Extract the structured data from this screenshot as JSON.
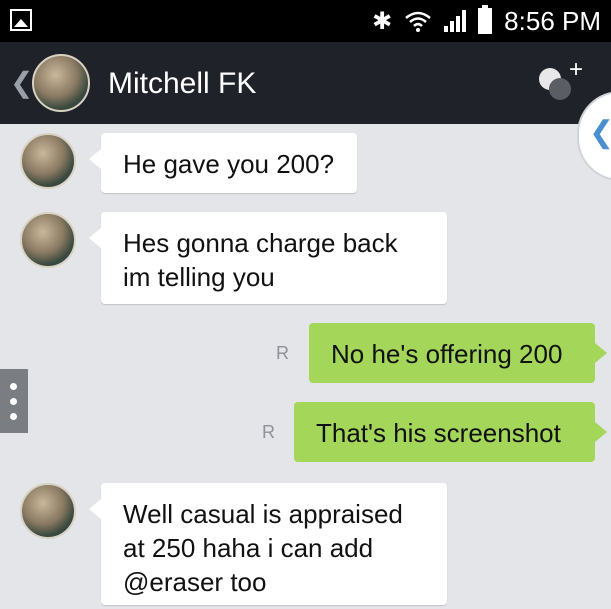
{
  "status_bar": {
    "time": "8:56 PM",
    "icons": [
      "gallery-icon",
      "bluetooth-icon",
      "wifi-icon",
      "signal-icon",
      "battery-icon"
    ]
  },
  "header": {
    "contact_name": "Mitchell FK",
    "icons": [
      "back-chevron-icon",
      "add-person-icon"
    ]
  },
  "messages": [
    {
      "direction": "incoming",
      "text": "He gave you 200?"
    },
    {
      "direction": "incoming",
      "text": "Hes gonna charge back im telling you"
    },
    {
      "direction": "outgoing",
      "text": "No he's offering 200",
      "read_mark": "R"
    },
    {
      "direction": "outgoing",
      "text": "That's his screenshot",
      "read_mark": "R"
    },
    {
      "direction": "incoming",
      "text": "Well casual is appraised at 250 haha i can add @eraser too"
    }
  ],
  "colors": {
    "background": "#e3e5e8",
    "header": "#1f2228",
    "outgoing_bubble": "#a4d65a",
    "incoming_bubble": "#ffffff"
  }
}
